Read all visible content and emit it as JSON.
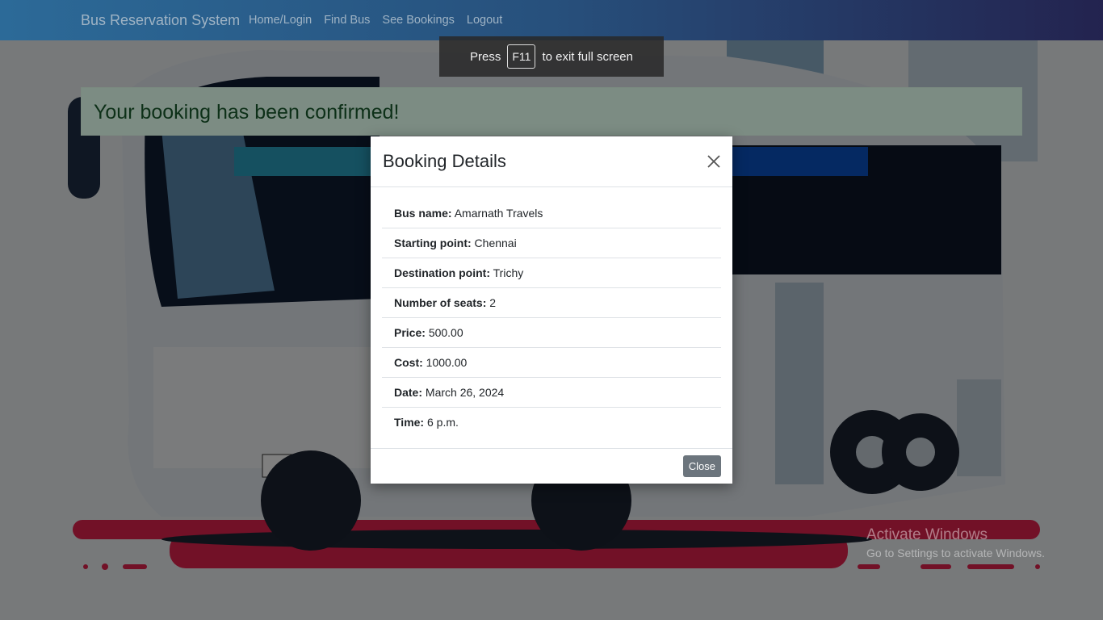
{
  "navbar": {
    "brand": "Bus Reservation System",
    "links": [
      "Home/Login",
      "Find Bus",
      "See Bookings",
      "Logout"
    ]
  },
  "fullscreen_toast": {
    "press": "Press",
    "key": "F11",
    "suffix": "to exit full screen"
  },
  "alert": {
    "message": "Your booking has been confirmed!"
  },
  "modal": {
    "title": "Booking Details",
    "details": [
      {
        "label": "Bus name:",
        "value": "Amarnath Travels"
      },
      {
        "label": "Starting point:",
        "value": "Chennai"
      },
      {
        "label": "Destination point:",
        "value": "Trichy"
      },
      {
        "label": "Number of seats:",
        "value": "2"
      },
      {
        "label": "Price:",
        "value": "500.00"
      },
      {
        "label": "Cost:",
        "value": "1000.00"
      },
      {
        "label": "Date:",
        "value": "March 26, 2024"
      },
      {
        "label": "Time:",
        "value": "6 p.m."
      }
    ],
    "close_button": "Close"
  },
  "watermark": {
    "title": "Activate Windows",
    "subtitle": "Go to Settings to activate Windows."
  },
  "colors": {
    "navbar_start": "#2c6a98",
    "navbar_end": "#23234f",
    "alert_bg": "#7c8c83",
    "alert_text": "#0d3018",
    "close_button_bg": "#6c757d"
  }
}
